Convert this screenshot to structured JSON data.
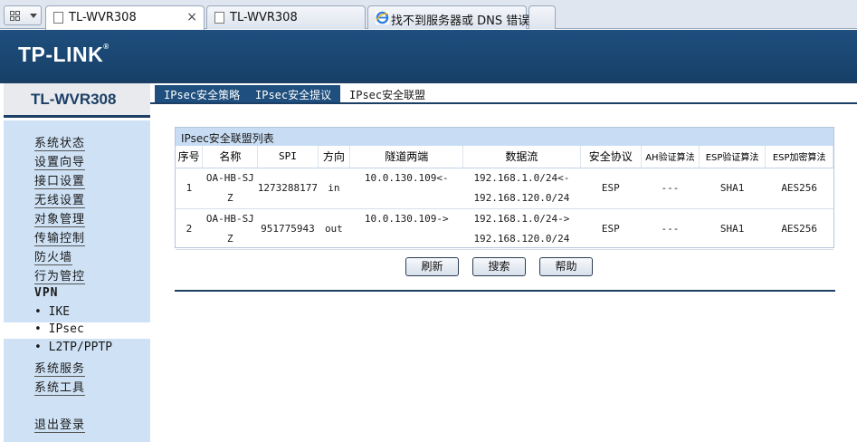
{
  "browser": {
    "tabs": [
      {
        "label": "TL-WVR308",
        "active": true,
        "close": "×"
      },
      {
        "label": "TL-WVR308",
        "active": false
      },
      {
        "label": "找不到服务器或 DNS 错误",
        "active": false,
        "icon": "ie-icon"
      }
    ]
  },
  "header": {
    "logo": "TP-LINK",
    "logo_mark": "®"
  },
  "model": "TL-WVR308",
  "page_tabs": [
    "IPsec安全策略",
    "IPsec安全提议",
    "IPsec安全联盟"
  ],
  "active_tab": "IPsec安全联盟",
  "sidebar": {
    "items": [
      "系统状态",
      "设置向导",
      "接口设置",
      "无线设置",
      "对象管理",
      "传输控制",
      "防火墙",
      "行为管控"
    ],
    "vpn_label": "VPN",
    "vpn_sub": [
      "• IKE",
      "• IPsec",
      "• L2TP/PPTP"
    ],
    "items2": [
      "系统服务",
      "系统工具"
    ],
    "logout": "退出登录"
  },
  "panel": {
    "title": "IPsec安全联盟列表",
    "columns": [
      "序号",
      "名称",
      "SPI",
      "方向",
      "隧道两端",
      "数据流",
      "安全协议",
      "AH验证算法",
      "ESP验证算法",
      "ESP加密算法"
    ],
    "rows": [
      {
        "no": "1",
        "name1": "OA-HB-SJ",
        "name2": "Z",
        "spi": "1273288177",
        "dir": "in",
        "tunnel": "10.0.130.109<-",
        "flow1": "192.168.1.0/24<-",
        "flow2": "192.168.120.0/24",
        "proto": "ESP",
        "ah": "---",
        "esp_auth": "SHA1",
        "esp_enc": "AES256"
      },
      {
        "no": "2",
        "name1": "OA-HB-SJ",
        "name2": "Z",
        "spi": "951775943",
        "dir": "out",
        "tunnel": "10.0.130.109->",
        "flow1": "192.168.1.0/24->",
        "flow2": "192.168.120.0/24",
        "proto": "ESP",
        "ah": "---",
        "esp_auth": "SHA1",
        "esp_enc": "AES256"
      }
    ]
  },
  "buttons": {
    "refresh": "刷新",
    "search": "搜索",
    "help": "帮助"
  }
}
